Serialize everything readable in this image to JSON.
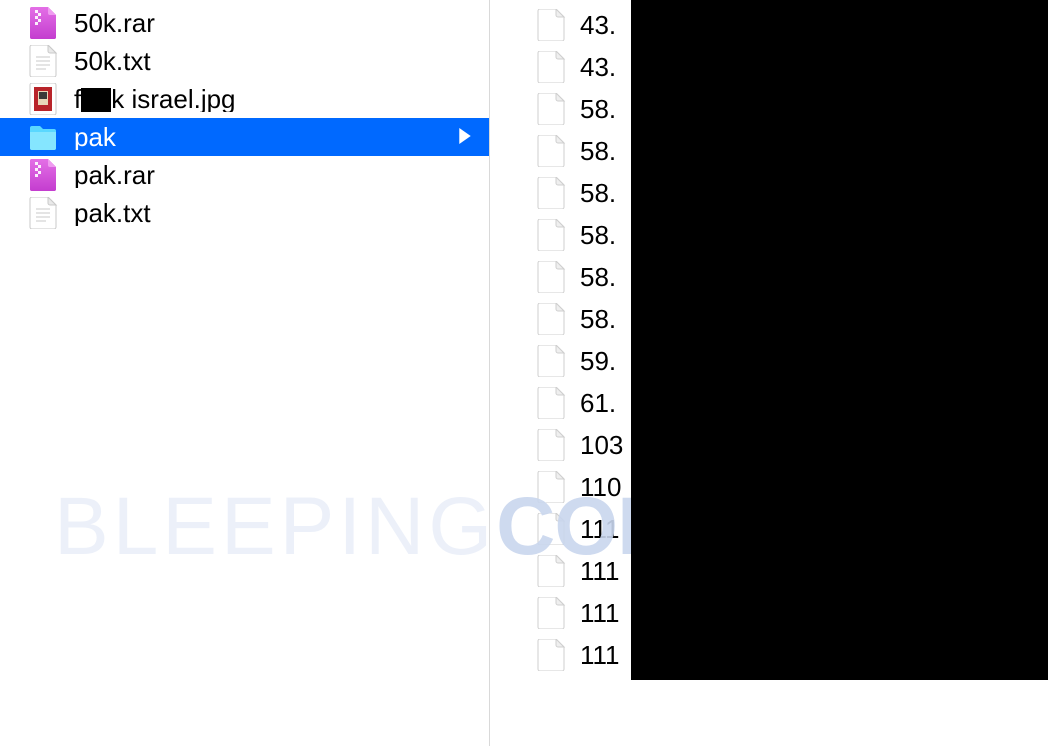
{
  "left_column": {
    "items": [
      {
        "label": "50k.rar",
        "icon": "rar-icon",
        "selected": false
      },
      {
        "label": "50k.txt",
        "icon": "txt-icon",
        "selected": false
      },
      {
        "label_prefix": "f",
        "label_suffix": "k israel.jpg",
        "icon": "jpg-icon",
        "selected": false,
        "censored": true
      },
      {
        "label": "pak",
        "icon": "folder-icon",
        "selected": true
      },
      {
        "label": "pak.rar",
        "icon": "rar-icon",
        "selected": false
      },
      {
        "label": "pak.txt",
        "icon": "txt-icon",
        "selected": false
      }
    ]
  },
  "right_column": {
    "items": [
      {
        "label": "43."
      },
      {
        "label": "43."
      },
      {
        "label": "58."
      },
      {
        "label": "58."
      },
      {
        "label": "58."
      },
      {
        "label": "58."
      },
      {
        "label": "58."
      },
      {
        "label": "58."
      },
      {
        "label": "59."
      },
      {
        "label": "61."
      },
      {
        "label": "103"
      },
      {
        "label": "110"
      },
      {
        "label": "111"
      },
      {
        "label": "111"
      },
      {
        "label": "111"
      },
      {
        "label": "111"
      }
    ]
  },
  "watermark": {
    "part1": "BLEEPING",
    "part2": "COMPUTER"
  }
}
